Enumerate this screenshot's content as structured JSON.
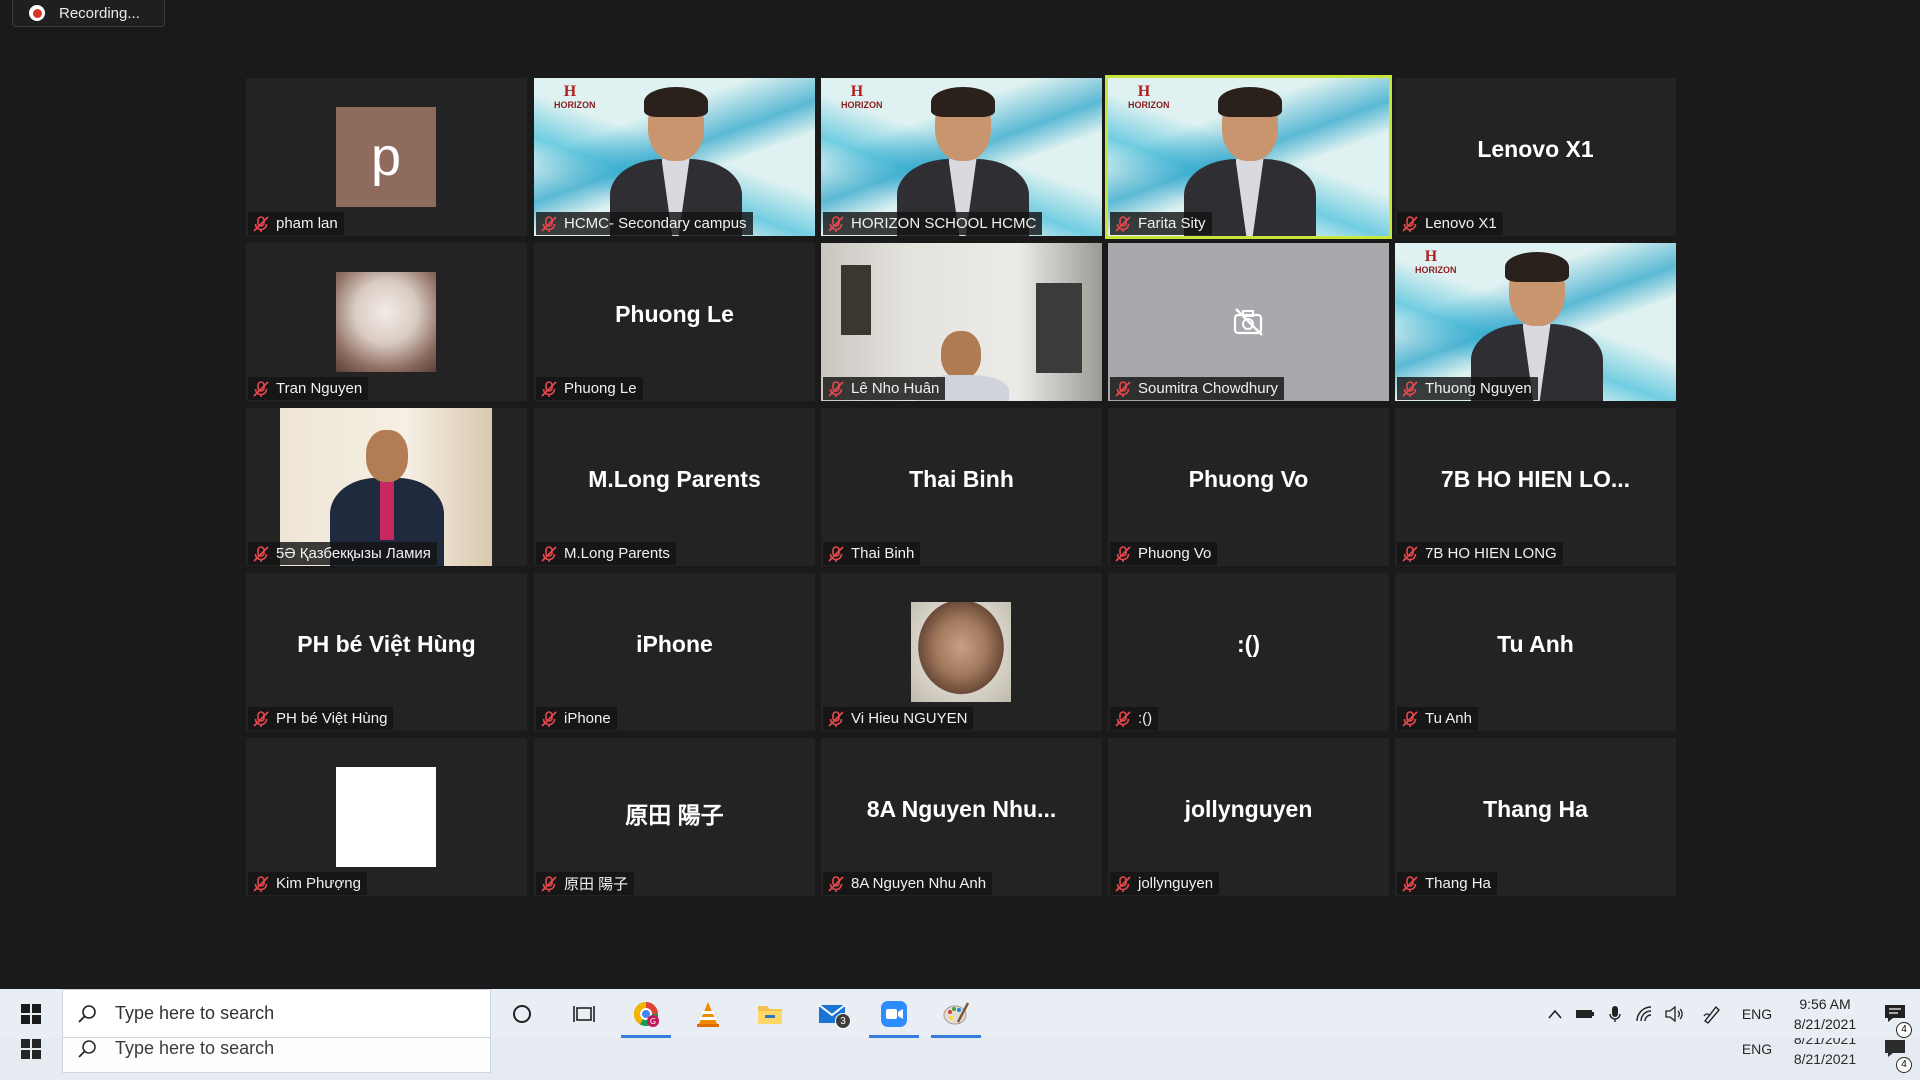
{
  "recording": {
    "label": "Recording..."
  },
  "participants": [
    {
      "id": "pham-lan",
      "name": "pham lan",
      "display": "avatar-letter",
      "avatar_letter": "p",
      "avatar_color": "#8e6b5c"
    },
    {
      "id": "hcmc-secondary",
      "name": "HCMC- Secondary campus",
      "display": "video-horizon",
      "logo_text": "HORIZON"
    },
    {
      "id": "horizon-school",
      "name": "HORIZON SCHOOL HCMC",
      "display": "video-horizon",
      "logo_text": "HORIZON"
    },
    {
      "id": "farita-sity",
      "name": "Farita Sity",
      "display": "video-horizon",
      "active_speaker": true,
      "logo_text": "HORIZON"
    },
    {
      "id": "lenovo-x1",
      "name": "Lenovo X1",
      "display": "name-only",
      "big_name": "Lenovo X1"
    },
    {
      "id": "tran-nguyen",
      "name": "Tran Nguyen",
      "display": "avatar-image"
    },
    {
      "id": "phuong-le",
      "name": "Phuong Le",
      "display": "name-only",
      "big_name": "Phuong Le"
    },
    {
      "id": "le-nho-huan",
      "name": "Lê Nho Huân",
      "display": "video-room"
    },
    {
      "id": "soumitra",
      "name": "Soumitra Chowdhury",
      "display": "camera-off"
    },
    {
      "id": "thuong-nguyen",
      "name": "Thuong Nguyen",
      "display": "video-horizon",
      "logo_text": "HORIZON"
    },
    {
      "id": "lamiya",
      "name": "5Ә Қазбекқызы Ламия",
      "display": "video-office"
    },
    {
      "id": "mlong",
      "name": "M.Long Parents",
      "display": "name-only",
      "big_name": "M.Long Parents"
    },
    {
      "id": "thai-binh",
      "name": "Thai Binh",
      "display": "name-only",
      "big_name": "Thai Binh"
    },
    {
      "id": "phuong-vo",
      "name": "Phuong Vo",
      "display": "name-only",
      "big_name": "Phuong Vo"
    },
    {
      "id": "7b-ho-hien",
      "name": "7B HO HIEN LONG",
      "display": "name-only",
      "big_name": "7B HO HIEN LO..."
    },
    {
      "id": "ph-be-viet-hung",
      "name": "PH bé Việt Hùng",
      "display": "name-only",
      "big_name": "PH bé Việt Hùng"
    },
    {
      "id": "iphone",
      "name": "iPhone",
      "display": "name-only",
      "big_name": "iPhone"
    },
    {
      "id": "vi-hieu",
      "name": "Vi Hieu NGUYEN",
      "display": "avatar-face"
    },
    {
      "id": "emoticon",
      "name": ":()",
      "display": "name-only",
      "big_name": ":()"
    },
    {
      "id": "tu-anh",
      "name": "Tu Anh",
      "display": "name-only",
      "big_name": "Tu Anh"
    },
    {
      "id": "kim-phuong",
      "name": "Kim Phượng",
      "display": "avatar-white"
    },
    {
      "id": "harada",
      "name": "原田 陽子",
      "display": "name-only",
      "big_name": "原田 陽子"
    },
    {
      "id": "8a-nguyen",
      "name": "8A Nguyen Nhu Anh",
      "display": "name-only",
      "big_name": "8A Nguyen Nhu..."
    },
    {
      "id": "jollynguyen",
      "name": "jollynguyen",
      "display": "name-only",
      "big_name": "jollynguyen"
    },
    {
      "id": "thang-ha",
      "name": "Thang Ha",
      "display": "name-only",
      "big_name": "Thang Ha"
    }
  ],
  "taskbar": {
    "search_placeholder": "Type here to search",
    "apps": [
      {
        "name": "chrome-icon",
        "badge": ""
      },
      {
        "name": "vlc-icon",
        "badge": ""
      },
      {
        "name": "file-explorer-icon",
        "badge": ""
      },
      {
        "name": "mail-icon",
        "badge": "3"
      },
      {
        "name": "zoom-icon",
        "badge": ""
      },
      {
        "name": "paint-icon",
        "badge": ""
      }
    ],
    "language": "ENG",
    "time": "9:56 AM",
    "date": "8/21/2021",
    "notifications": "4"
  },
  "colors": {
    "active_speaker_border": "#c7e53b",
    "tile_bg": "#232323",
    "page_bg": "#1a1a1a",
    "mute_icon": "#e5484d"
  }
}
